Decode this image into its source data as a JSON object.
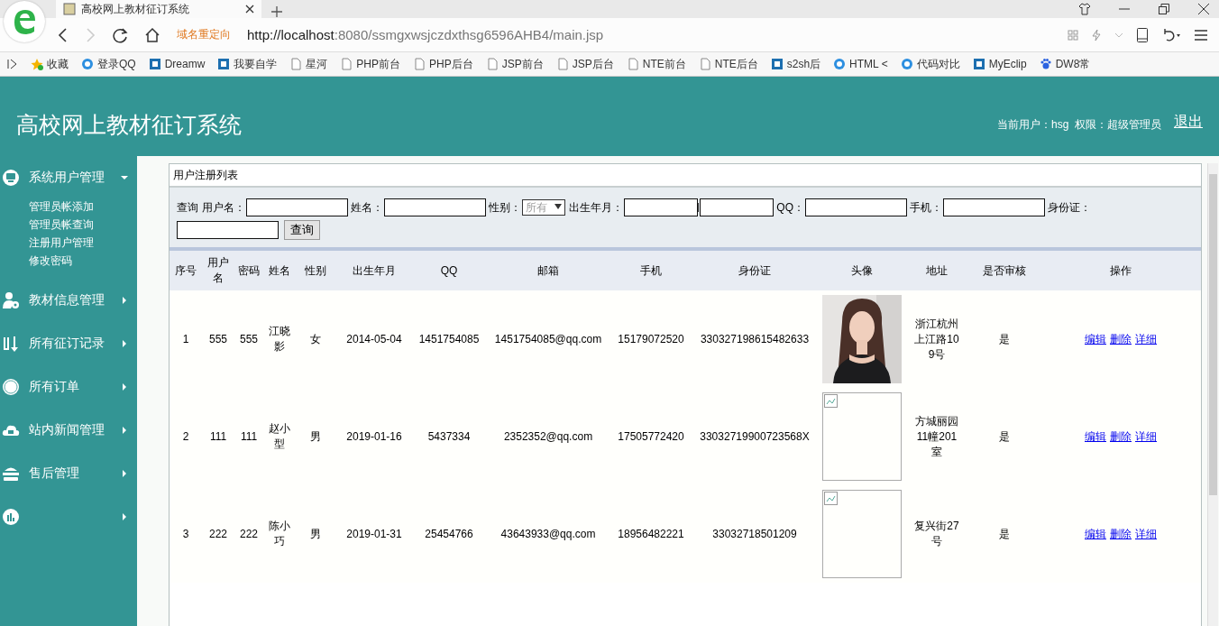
{
  "browser": {
    "tab_title": "高校网上教材征订系统",
    "redirect_label": "域名重定向",
    "url_host": "http://localhost",
    "url_rest": ":8080/ssmgxwsjczdxthsg6596AHB4/main.jsp",
    "bookmarks": [
      {
        "label": "收藏",
        "kind": "star"
      },
      {
        "label": "登录QQ",
        "kind": "circle"
      },
      {
        "label": "Dreamw",
        "kind": "square"
      },
      {
        "label": "我要自学",
        "kind": "square"
      },
      {
        "label": "星河",
        "kind": "page"
      },
      {
        "label": "PHP前台",
        "kind": "page"
      },
      {
        "label": "PHP后台",
        "kind": "page"
      },
      {
        "label": "JSP前台",
        "kind": "page"
      },
      {
        "label": "JSP后台",
        "kind": "page"
      },
      {
        "label": "NTE前台",
        "kind": "page"
      },
      {
        "label": "NTE后台",
        "kind": "page"
      },
      {
        "label": "s2sh后",
        "kind": "square"
      },
      {
        "label": "HTML <",
        "kind": "circle"
      },
      {
        "label": "代码对比",
        "kind": "circle"
      },
      {
        "label": "MyEclip",
        "kind": "square"
      },
      {
        "label": "DW8常",
        "kind": "paw"
      }
    ]
  },
  "header": {
    "title": "高校网上教材征订系统",
    "user_info": "当前用户：hsg  权限：超级管理员",
    "logout": "退出"
  },
  "sidebar": {
    "items": [
      {
        "label": "系统用户管理",
        "expanded": true,
        "children": [
          {
            "label": "管理员帐添加"
          },
          {
            "label": "管理员帐查询"
          },
          {
            "label": "注册用户管理"
          },
          {
            "label": "修改密码"
          }
        ]
      },
      {
        "label": "教材信息管理",
        "expanded": false
      },
      {
        "label": "所有征订记录",
        "expanded": false
      },
      {
        "label": "所有订单",
        "expanded": false
      },
      {
        "label": "站内新闻管理",
        "expanded": false
      },
      {
        "label": "售后管理",
        "expanded": false
      },
      {
        "expanded": false
      }
    ]
  },
  "panel": {
    "title": "用户注册列表",
    "search": {
      "prefix": "查询",
      "fields": [
        {
          "label": "用户名：",
          "kind": "text"
        },
        {
          "label": "姓名：",
          "kind": "text"
        },
        {
          "label": "性别：",
          "kind": "select",
          "value": "所有"
        },
        {
          "label": "出生年月：",
          "kind": "range"
        },
        {
          "label": "QQ：",
          "kind": "text"
        },
        {
          "label": "手机：",
          "kind": "text"
        },
        {
          "label": "身份证：",
          "kind": "text"
        }
      ],
      "button": "查询"
    },
    "table": {
      "columns": [
        "序号",
        "用户名",
        "密码",
        "姓名",
        "性别",
        "出生年月",
        "QQ",
        "邮箱",
        "手机",
        "身份证",
        "头像",
        "地址",
        "是否审核",
        "操作"
      ],
      "rows": [
        {
          "cells": [
            "1",
            "555",
            "555",
            "江晓影",
            "女",
            "2014-05-04",
            "1451754085",
            "1451754085@qq.com",
            "15179072520",
            "330327198615482633"
          ],
          "avatar": {
            "kind": "picture"
          },
          "address": "浙江杭州上江路109号",
          "approved": "是",
          "actions": [
            "编辑",
            "删除",
            "详细"
          ]
        },
        {
          "cells": [
            "2",
            "111",
            "111",
            "赵小型",
            "男",
            "2019-01-16",
            "5437334",
            "2352352@qq.com",
            "17505772420",
            "33032719900723568X"
          ],
          "avatar": {
            "kind": "broken"
          },
          "address": "方城丽园11幢201室",
          "approved": "是",
          "actions": [
            "编辑",
            "删除",
            "详细"
          ]
        },
        {
          "cells": [
            "3",
            "222",
            "222",
            "陈小巧",
            "男",
            "2019-01-31",
            "25454766",
            "43643933@qq.com",
            "18956482221",
            "33032718501209"
          ],
          "avatar": {
            "kind": "broken"
          },
          "address": "复兴街27号",
          "approved": "是",
          "actions": [
            "编辑",
            "删除",
            "详细"
          ]
        }
      ]
    }
  }
}
